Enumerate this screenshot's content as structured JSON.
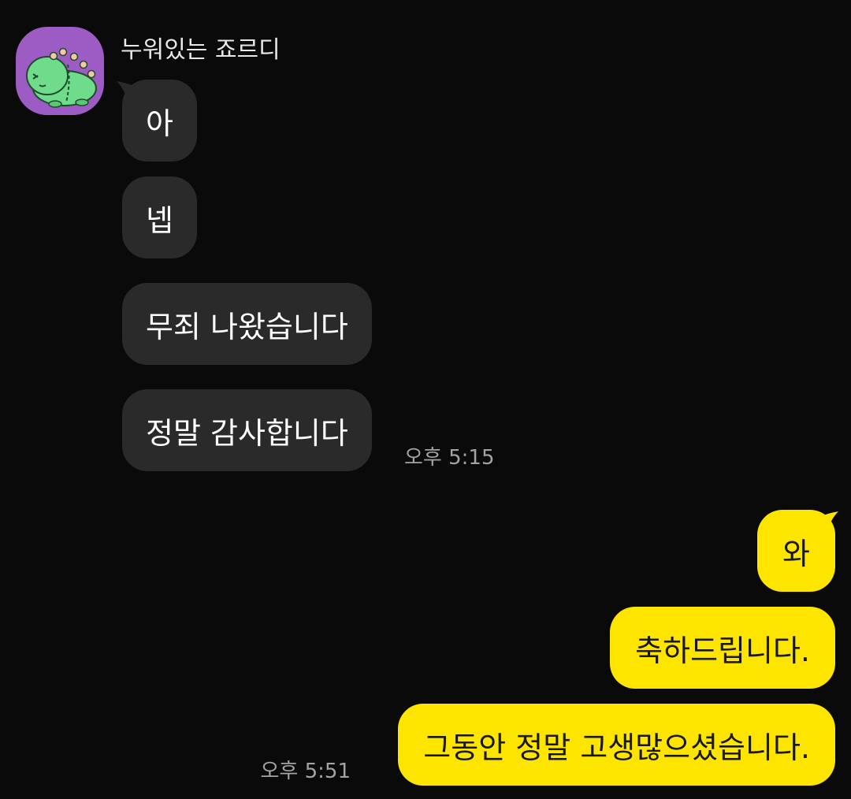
{
  "chat": {
    "sender_name": "누워있는 죠르디",
    "incoming": [
      {
        "text": "아"
      },
      {
        "text": "넵"
      },
      {
        "text": "무죄 나왔습니다"
      },
      {
        "text": "정말 감사합니다"
      }
    ],
    "incoming_time": "오후 5:15",
    "outgoing": [
      {
        "text": "와"
      },
      {
        "text": "축하드립니다."
      },
      {
        "text": "그동안 정말 고생많으셨습니다."
      }
    ],
    "outgoing_time": "오후 5:51"
  },
  "colors": {
    "background": "#0a0a0a",
    "incoming_bubble": "#2a2a2a",
    "outgoing_bubble": "#fee500",
    "avatar_bg": "#9d5cc4"
  },
  "icons": {
    "avatar": "green-dinosaur-avatar-icon"
  }
}
